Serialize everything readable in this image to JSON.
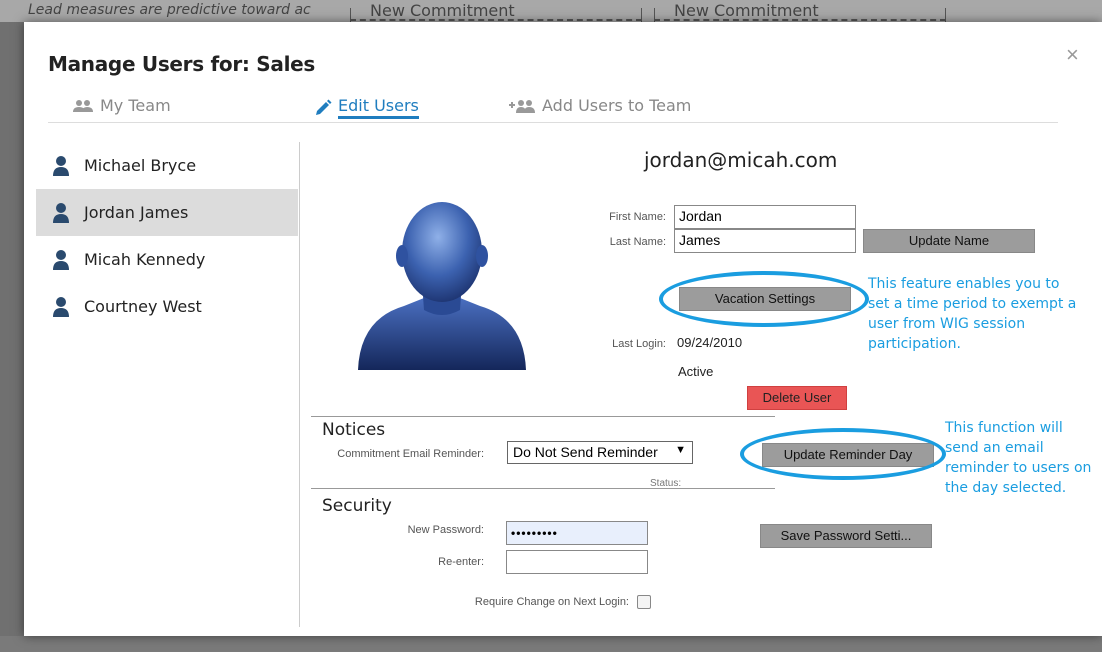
{
  "background": {
    "lead_text": "Lead measures are predictive toward ac",
    "commitment_1": "New Commitment",
    "commitment_2": "New Commitment"
  },
  "modal": {
    "title": "Manage Users for: Sales",
    "close_glyph": "×"
  },
  "tabs": [
    {
      "label": "My Team",
      "icon": "team-icon"
    },
    {
      "label": "Edit Users",
      "icon": "pencil-icon",
      "active": true
    },
    {
      "label": "Add Users to Team",
      "icon": "add-users-icon"
    }
  ],
  "users": [
    {
      "name": "Michael Bryce"
    },
    {
      "name": "Jordan James",
      "selected": true
    },
    {
      "name": "Micah Kennedy"
    },
    {
      "name": "Courtney West"
    }
  ],
  "detail": {
    "email": "jordan@micah.com",
    "first_name_label": "First Name:",
    "first_name_value": "Jordan",
    "last_name_label": "Last Name:",
    "last_name_value": "James",
    "update_name_button": "Update Name",
    "vacation_button": "Vacation Settings",
    "last_login_label": "Last Login:",
    "last_login_value": "09/24/2010",
    "status_value": "Active",
    "delete_button": "Delete User"
  },
  "notices": {
    "title": "Notices",
    "reminder_label": "Commitment Email Reminder:",
    "reminder_value": "Do Not Send Reminder",
    "update_reminder_button": "Update Reminder Day",
    "status_label": "Status:"
  },
  "security": {
    "title": "Security",
    "new_password_label": "New Password:",
    "new_password_value": "•••••••••",
    "reenter_label": "Re-enter:",
    "reenter_value": "",
    "save_button": "Save Password Setti...",
    "require_change_label": "Require Change on Next Login:",
    "require_change_checked": false
  },
  "annotations": {
    "vacation_note_lines": [
      "This feature enables you to",
      "set a time period to exempt a",
      "user from WIG session",
      "participation."
    ],
    "reminder_note_lines": [
      "This function will",
      "send an email",
      "reminder to users on",
      "the day selected."
    ]
  },
  "colors": {
    "accent": "#1f7dbf",
    "annotation": "#1a9de0",
    "delete": "#e95555",
    "button_gray": "#9c9c9c"
  }
}
